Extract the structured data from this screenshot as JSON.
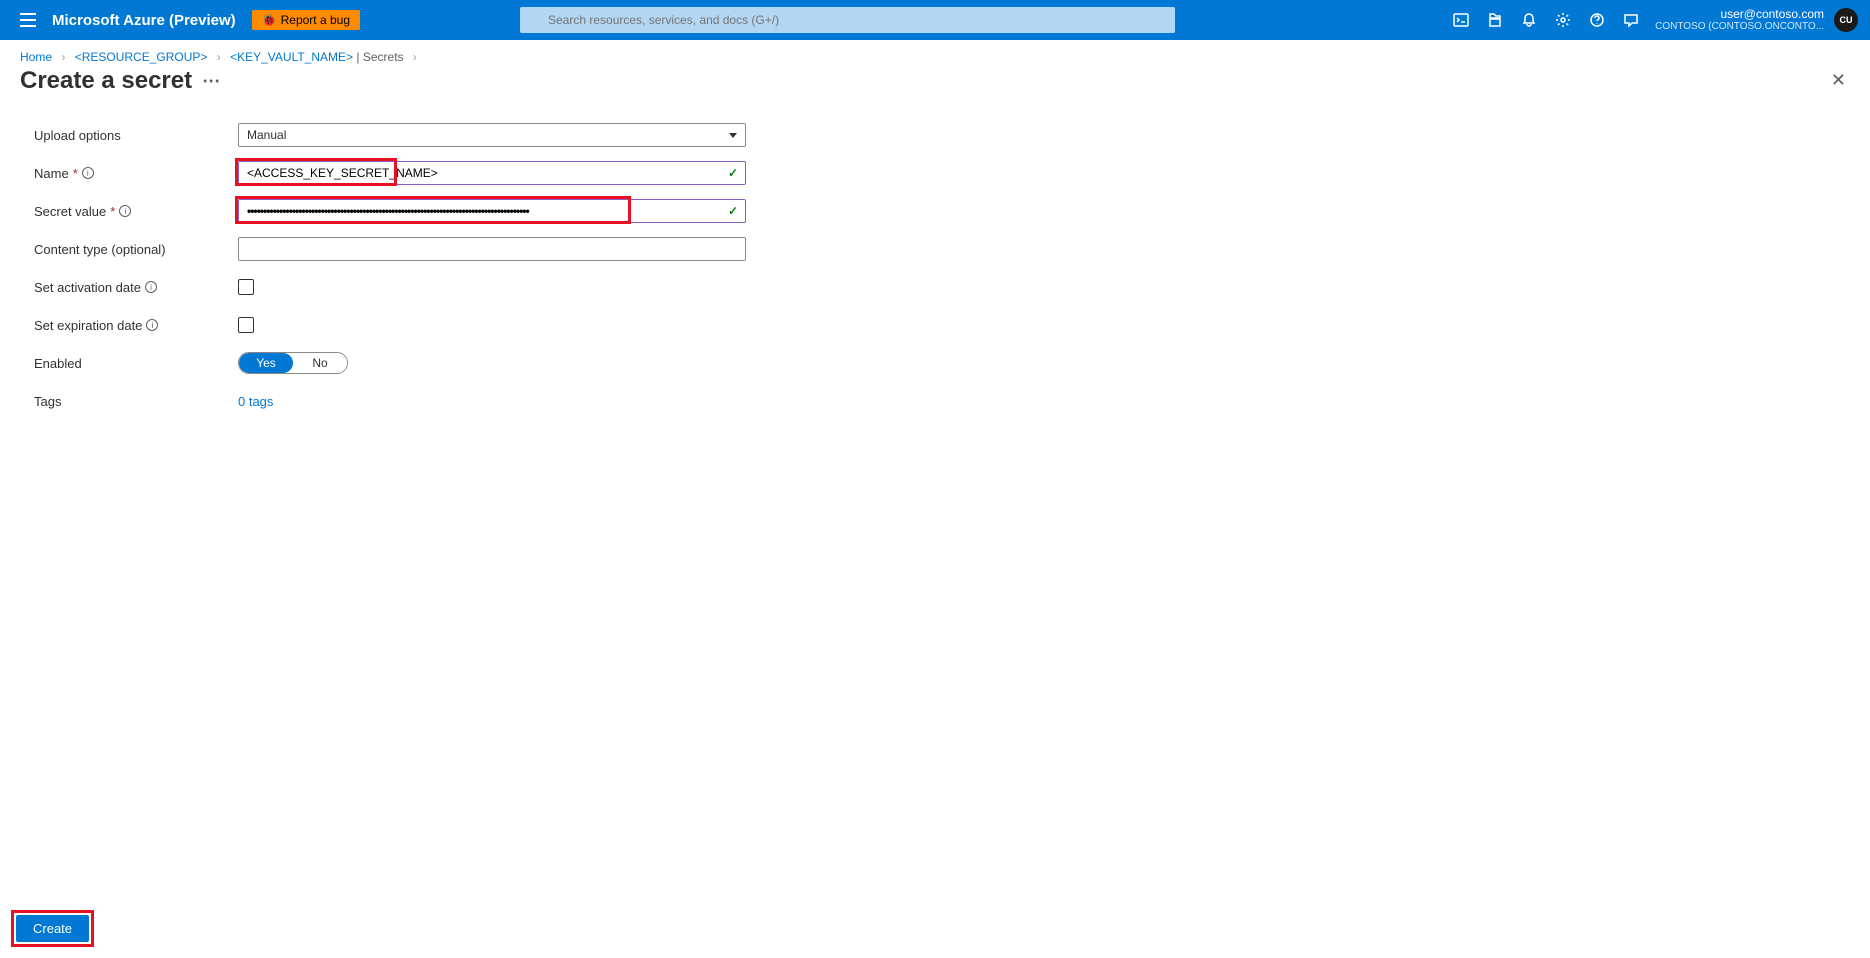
{
  "header": {
    "brand": "Microsoft Azure (Preview)",
    "report_bug": "Report a bug",
    "search_placeholder": "Search resources, services, and docs (G+/)",
    "user_email": "user@contoso.com",
    "user_tenant": "CONTOSO (CONTOSO.ONCONTO...",
    "avatar_initials": "CU"
  },
  "breadcrumb": {
    "home": "Home",
    "rg": "<RESOURCE_GROUP>",
    "kv": "<KEY_VAULT_NAME>",
    "kv_section": "Secrets"
  },
  "page": {
    "title": "Create a secret"
  },
  "form": {
    "upload_options_label": "Upload options",
    "upload_options_value": "Manual",
    "name_label": "Name",
    "name_value": "<ACCESS_KEY_SECRET_NAME>",
    "secret_value_label": "Secret value",
    "secret_value_value": "••••••••••••••••••••••••••••••••••••••••••••••••••••••••••••••••••••••••••••••••••••••••",
    "content_type_label": "Content type (optional)",
    "content_type_value": "",
    "activation_label": "Set activation date",
    "expiration_label": "Set expiration date",
    "enabled_label": "Enabled",
    "enabled_yes": "Yes",
    "enabled_no": "No",
    "tags_label": "Tags",
    "tags_link": "0 tags"
  },
  "footer": {
    "create": "Create"
  }
}
